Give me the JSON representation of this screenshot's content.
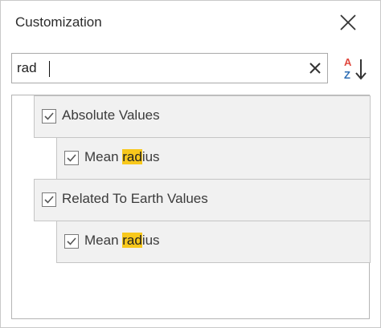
{
  "window": {
    "title": "Customization"
  },
  "search": {
    "value": "rad",
    "placeholder": ""
  },
  "icons": {
    "close": "close-icon",
    "clear": "clear-icon",
    "sort": "sort-alphabetical-icon"
  },
  "tree": {
    "highlight_color": "#f8c81c",
    "groups": [
      {
        "label": "Absolute Values",
        "checked": true,
        "children": [
          {
            "label_before": "Mean ",
            "label_match": "rad",
            "label_after": "ius",
            "checked": true
          }
        ]
      },
      {
        "label": "Related To Earth Values",
        "checked": true,
        "children": [
          {
            "label_before": "Mean ",
            "label_match": "rad",
            "label_after": "ius",
            "checked": true
          }
        ]
      }
    ]
  }
}
